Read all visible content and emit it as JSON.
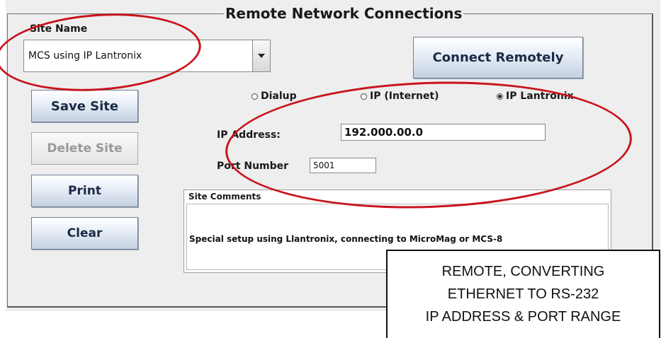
{
  "group_title": "Remote Network Connections",
  "site_name": {
    "label": "Site Name",
    "value": "MCS using IP Lantronix"
  },
  "buttons": {
    "connect_remotely": "Connect Remotely",
    "save_site": "Save Site",
    "delete_site": "Delete Site",
    "print": "Print",
    "clear": "Clear"
  },
  "connection_type": {
    "options": [
      {
        "label": "Dialup",
        "selected": false
      },
      {
        "label": "IP (Internet)",
        "selected": false
      },
      {
        "label": "IP Lantronix",
        "selected": true
      }
    ]
  },
  "ip_address": {
    "label": "IP Address:",
    "value": "192.000.00.0"
  },
  "port_number": {
    "label": "Port Number",
    "value": "5001"
  },
  "site_comments": {
    "label": "Site Comments",
    "value": "Special setup using Llantronix, connecting to MicroMag or MCS-8"
  },
  "annotation": {
    "lines": [
      "REMOTE, CONVERTING",
      "ETHERNET TO RS-232",
      "IP ADDRESS & PORT RANGE"
    ],
    "highlight_color": "#c8141c"
  }
}
